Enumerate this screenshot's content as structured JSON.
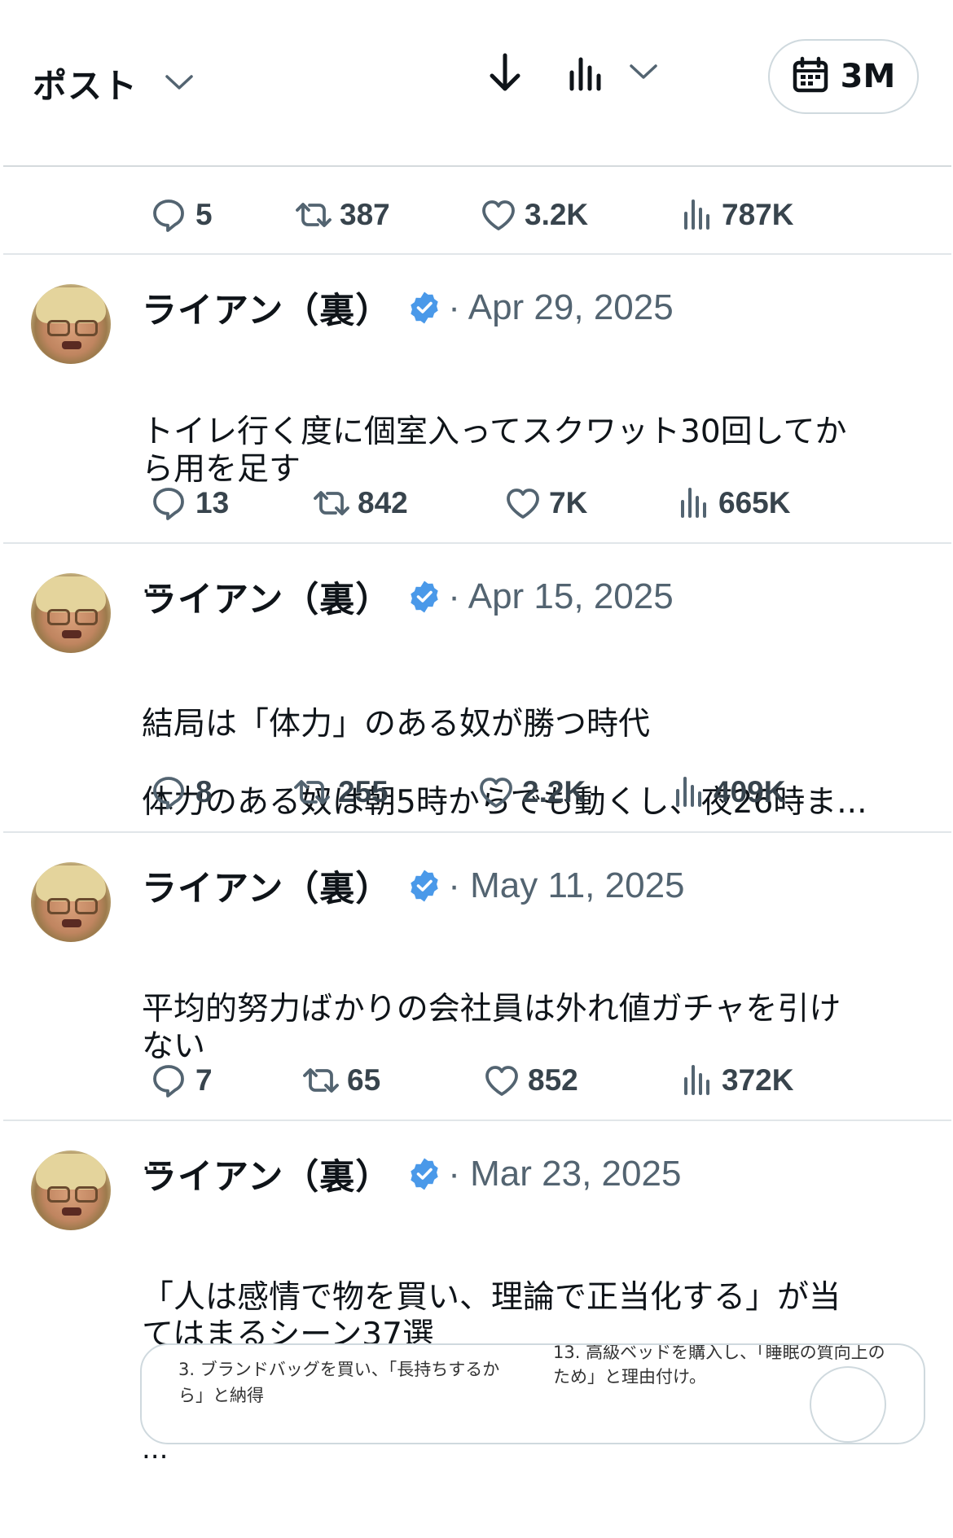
{
  "header": {
    "selector_label": "ポスト",
    "date_range_label": "3M"
  },
  "first_metrics": {
    "replies": "5",
    "reposts": "387",
    "likes": "3.2K",
    "views": "787K"
  },
  "posts": [
    {
      "author": "ライアン（裏）",
      "date": "· Apr 29, 2025",
      "text": "トイレ行く度に個室入ってスクワット30回してか\nら用を足す",
      "ellipsis": "...",
      "replies": "13",
      "reposts": "842",
      "likes": "7K",
      "views": "665K"
    },
    {
      "author": "ライアン（裏）",
      "date": "· Apr 15, 2025",
      "text": "結局は「体力」のある奴が勝つ時代\n\n体力のある奴は朝5時からでも動くし、夜26時ま...",
      "ellipsis": "",
      "replies": "8",
      "reposts": "255",
      "likes": "2.2K",
      "views": "409K"
    },
    {
      "author": "ライアン（裏）",
      "date": "· May 11, 2025",
      "text": "平均的努力ばかりの会社員は外れ値ガチャを引け\nない",
      "ellipsis": "...",
      "replies": "7",
      "reposts": "65",
      "likes": "852",
      "views": "372K"
    },
    {
      "author": "ライアン（裏）",
      "date": "· Mar 23, 2025",
      "text": "「人は感情で物を買い、理論で正当化する」が当\nてはまるシーン37選",
      "ellipsis": "...",
      "replies": "",
      "reposts": "",
      "likes": "",
      "views": ""
    }
  ],
  "image_card": {
    "left_text": "3. ブランドバッグを買い、「長持ちするか\nら」と納得",
    "right_text": "13. 高級ベッドを購入し、「睡眠の質向上の\nため」と理由付け。"
  },
  "icons": {
    "header": [
      "chevron-down-icon",
      "download-icon",
      "analytics-icon",
      "chevron-down-icon",
      "calendar-icon"
    ],
    "metrics": [
      "reply-icon",
      "repost-icon",
      "like-icon",
      "views-icon"
    ],
    "badge": "verified-badge-icon"
  },
  "colors": {
    "verified_blue": "#4a99e9",
    "muted_text": "#536471",
    "metric_text": "#38444d"
  }
}
